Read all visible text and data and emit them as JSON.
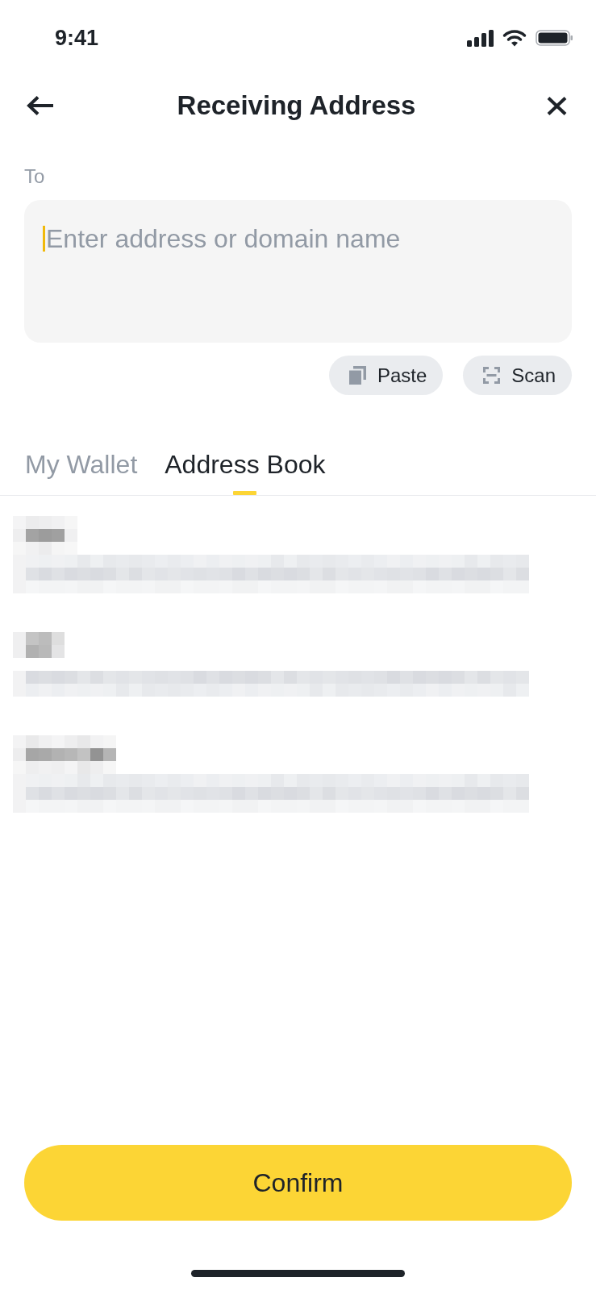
{
  "status_bar": {
    "time": "9:41"
  },
  "header": {
    "title": "Receiving Address"
  },
  "address_field": {
    "label": "To",
    "placeholder": "Enter address or domain name",
    "focused": true
  },
  "field_actions": [
    {
      "kind": "paste",
      "label": "Paste"
    },
    {
      "kind": "scan",
      "label": "Scan"
    }
  ],
  "tabs": [
    {
      "label": "My Wallet",
      "selected": false
    },
    {
      "label": "Address Book",
      "selected": true
    }
  ],
  "confirm_button": {
    "label": "Confirm"
  }
}
